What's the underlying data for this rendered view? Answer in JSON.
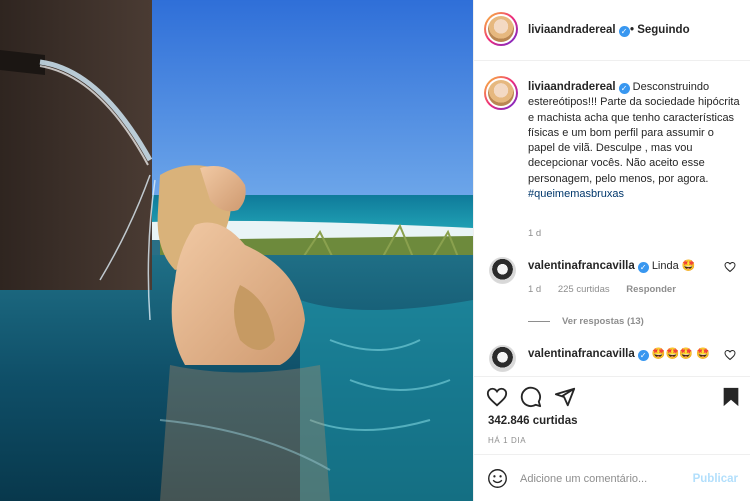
{
  "post": {
    "username": "liviaandradereal",
    "follow_status": "• Seguindo",
    "caption": "Desconstruindo estereótipos!!! Parte da sociedade hipócrita e machista acha que tenho características físicas e um bom perfil para assumir o papel de vilã. Desculpe , mas vou decepcionar vocês. Não aceito esse personagem, pelo menos, por agora.",
    "hashtag": "#queimemasbruxas",
    "caption_age": "1 d"
  },
  "comments": [
    {
      "username": "valentinafrancavilla",
      "text": "Linda 🤩",
      "age": "1 d",
      "likes": "225 curtidas",
      "reply_label": "Responder",
      "view_replies": "Ver respostas (13)"
    },
    {
      "username": "valentinafrancavilla",
      "text": "🤩🤩🤩 🤩"
    }
  ],
  "stats": {
    "likes": "342.846 curtidas",
    "time_ago": "HÁ 1 DIA"
  },
  "comment_box": {
    "placeholder": "Adicione um comentário...",
    "publish_label": "Publicar"
  },
  "icons": [
    "heart-icon",
    "comment-icon",
    "share-icon",
    "bookmark-icon",
    "emoji-icon",
    "verified-icon"
  ],
  "colors": {
    "verified": "#3897f0",
    "link": "#00376b",
    "muted": "#8e8e8e",
    "publish_disabled": "#b2dffc"
  }
}
